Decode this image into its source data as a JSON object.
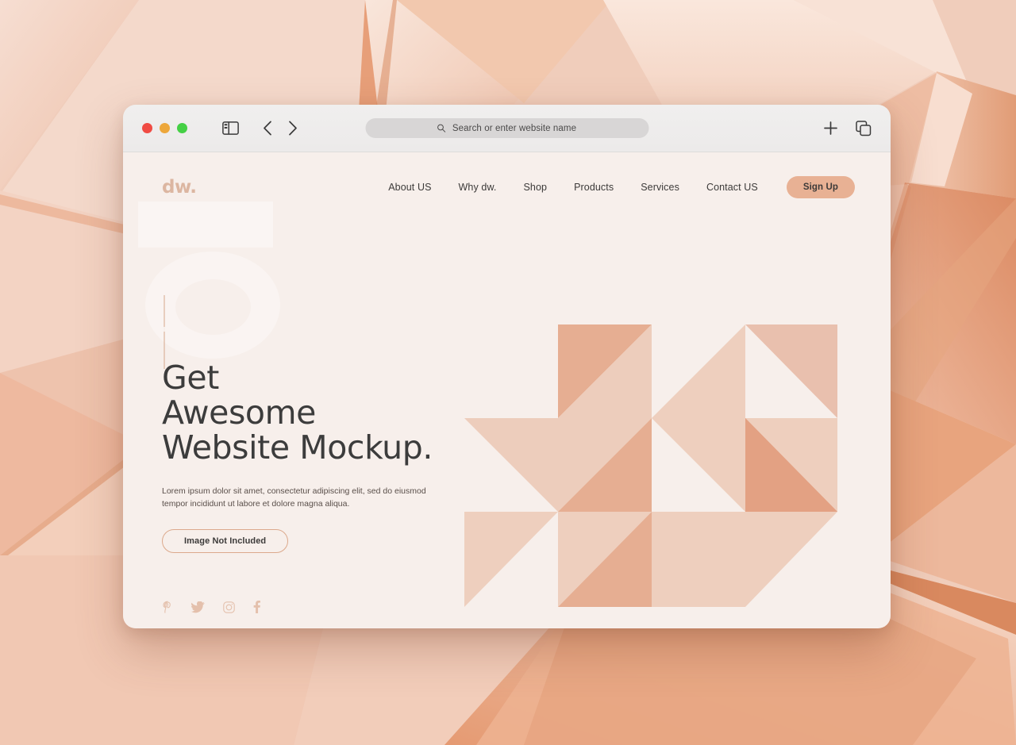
{
  "background": {
    "description": "abstract 3d folded paper peach geometric render",
    "colors": [
      "#f2d6c8",
      "#edbfa9",
      "#e09873",
      "#f7e0d3",
      "#d98a64",
      "#f9e8df"
    ]
  },
  "browser": {
    "traffic_lights": [
      {
        "name": "close",
        "color": "#f04b43"
      },
      {
        "name": "minimize",
        "color": "#eda73a"
      },
      {
        "name": "maximize",
        "color": "#45d045"
      }
    ],
    "sidebar_icon": "sidebar-toggle-icon",
    "back_icon": "chevron-left-icon",
    "forward_icon": "chevron-right-icon",
    "urlbar": {
      "icon": "search-icon",
      "placeholder": "Search or enter website name",
      "value": "Search or enter website name"
    },
    "new_tab_icon": "plus-icon",
    "tab_overview_icon": "tab-overview-icon"
  },
  "site": {
    "logo": "dw.",
    "nav": [
      {
        "label": "About US"
      },
      {
        "label": "Why dw."
      },
      {
        "label": "Shop"
      },
      {
        "label": "Products"
      },
      {
        "label": "Services"
      },
      {
        "label": "Contact US"
      }
    ],
    "signup_label": "Sign Up",
    "hero": {
      "headline_lines": [
        "Get",
        "Awesome",
        "Website Mockup."
      ],
      "headline": "Get Awesome Website Mockup.",
      "description": "Lorem ipsum dolor sit amet, consectetur adipiscing elit, sed do eiusmod tempor incididunt ut labore et dolore magna aliqua.",
      "cta_label": "Image Not Included"
    },
    "social": [
      {
        "name": "pinterest-icon",
        "label": "Pinterest"
      },
      {
        "name": "twitter-icon",
        "label": "Twitter"
      },
      {
        "name": "instagram-icon",
        "label": "Instagram"
      },
      {
        "name": "facebook-icon",
        "label": "Facebook"
      }
    ],
    "colors": {
      "page_bg": "#f7efeb",
      "accent": "#e8b194",
      "logo": "#dcb6a1",
      "text": "#3c3a39",
      "art_light": "#f2ded5",
      "art_mid": "#edcdbc",
      "art_dark": "#e6ae92"
    },
    "artwork": {
      "type": "triangle-pinwheel-grid",
      "cols": 4,
      "rows": 4,
      "cell": 118
    }
  }
}
